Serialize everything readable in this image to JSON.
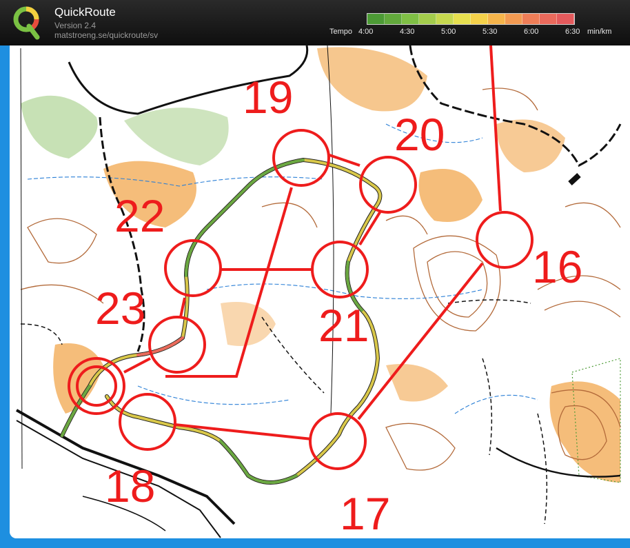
{
  "app": {
    "name": "QuickRoute",
    "version": "Version 2.4",
    "url": "matstroeng.se/quickroute/sv"
  },
  "tempo_scale": {
    "label": "Tempo",
    "ticks": [
      "4:00",
      "4:30",
      "5:00",
      "5:30",
      "6:00",
      "6:30"
    ],
    "unit": "min/km",
    "colors": [
      "#4c9a35",
      "#62a93c",
      "#7fbf45",
      "#a3cc4c",
      "#c6d84f",
      "#e6df4f",
      "#f4d14a",
      "#f5b44b",
      "#f29a52",
      "#ee7d57",
      "#ea6a5c",
      "#e45a5c"
    ]
  },
  "map": {
    "colors": {
      "course": "#ee1c1c",
      "route_fast": "#6aa842",
      "route_slow": "#d9c84a",
      "vegetation": "#f5bd7a",
      "green": "#b9d9a3",
      "contour": "#b36a3a",
      "water": "#2a7fd6",
      "track": "#111111"
    },
    "controls": [
      {
        "id": "16",
        "label": "16"
      },
      {
        "id": "17",
        "label": "17"
      },
      {
        "id": "18",
        "label": "18"
      },
      {
        "id": "19",
        "label": "19"
      },
      {
        "id": "20",
        "label": "20"
      },
      {
        "id": "21",
        "label": "21"
      },
      {
        "id": "22",
        "label": "22"
      },
      {
        "id": "23",
        "label": "23"
      }
    ]
  }
}
